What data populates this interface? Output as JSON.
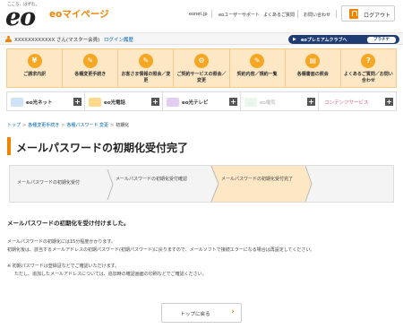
{
  "header": {
    "tagline": "こころ、はずむ。",
    "logo_eo": "eo",
    "logo_mypage": "eoマイページ",
    "nav": [
      "eonet.jp",
      "eoユーザーサポート",
      "よくあるご質問",
      "お問い合わせ"
    ],
    "logout": "ログアウト"
  },
  "userbar": {
    "user_name": "XXXXXXXXXXXX さん(マスター会員)",
    "login_history": "ログイン履歴",
    "premium": "eoプレミアムクラブへ",
    "rank": "プラチナ"
  },
  "menu": {
    "items": [
      {
        "icon": "¥",
        "label": "ご請求内訳"
      },
      {
        "icon": "✎",
        "label": "各種変更手続き"
      },
      {
        "icon": "✎",
        "label": "お客さま情報の照会／変更"
      },
      {
        "icon": "⚙",
        "label": "ご契約サービスの照会／変更"
      },
      {
        "icon": "✎",
        "label": "契約内容／規約一覧"
      },
      {
        "icon": "▤",
        "label": "各種書面の照会"
      },
      {
        "icon": "?",
        "label": "よくあるご質問／お問い合わせ"
      }
    ]
  },
  "services": {
    "items": [
      {
        "label": "eo光ネット",
        "color": "#e8f2fb"
      },
      {
        "label": "eo光電話",
        "color": "#fff1d6"
      },
      {
        "label": "eo光テレビ",
        "color": "#f3e8fb"
      },
      {
        "label": "eo電気",
        "color": "#e6f5ea"
      },
      {
        "label": "コンテンツサービス",
        "color": "#ffffff"
      }
    ],
    "plus": "+"
  },
  "breadcrumb": {
    "items": [
      "トップ",
      "各種変更手続き",
      "各種パスワード 変更",
      "初期化"
    ]
  },
  "page": {
    "title": "メールパスワードの初期化受付完了"
  },
  "steps": {
    "items": [
      "メールパスワードの初期化受付",
      "メールパスワードの初期化受付確認",
      "メールパスワードの初期化受付完了"
    ]
  },
  "message": {
    "heading": "メールパスワードの初期化を受け付けました。",
    "p1": "メールパスワードの初期化には15分程度かかります。",
    "p2": "初期化後は、該当するメールアドレスの初期パスワード(初期パスワード)に戻りますので、メールソフトで接続エラーになる場合は再設定してください。",
    "note1": "※ 初期パスワードは登録証などでご確認いただけます。",
    "note2": "ただし、追加したメールアドレスについては、追加時の確認画面の印刷などでご確認ください。"
  },
  "footer_button": {
    "label": "トップに戻る"
  }
}
